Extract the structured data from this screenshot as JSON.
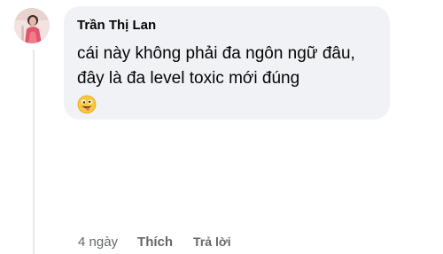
{
  "comment": {
    "author": "Trần Thị Lan",
    "text": "cái này không phải đa ngôn ngữ đâu, đây là đa level toxic mới đúng",
    "emoji": "goofy-face-emoji",
    "avatar": "user-avatar-photo"
  },
  "actions": {
    "time": "4 ngày",
    "like_label": "Thích",
    "reply_label": "Trả lời"
  }
}
